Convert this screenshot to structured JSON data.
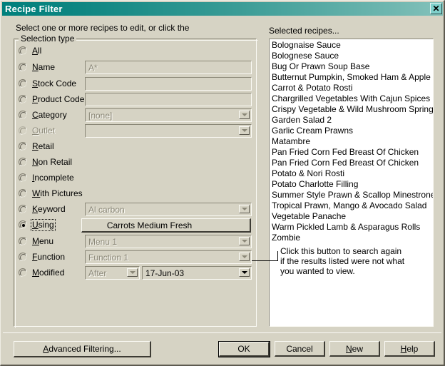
{
  "window": {
    "title": "Recipe Filter",
    "close_icon": "close-icon",
    "close_glyph": "✕",
    "colors": {
      "titlebar_from": "#00807c",
      "titlebar_to": "#84c2bb",
      "dialog_face": "#d6d3c4",
      "disabled_text": "#8b8878",
      "list_bg": "#ffffff"
    }
  },
  "prompt": "Select one or more recipes to edit, or click the",
  "list_caption": "Selected recipes...",
  "groupbox": {
    "label": "Selection type",
    "rows": [
      {
        "label": "All",
        "mnemonic": "A",
        "selected": false,
        "disabled": false,
        "control": "none"
      },
      {
        "label": "Name",
        "mnemonic": "N",
        "selected": false,
        "disabled": false,
        "control": "text",
        "value": "A*",
        "control_disabled": true
      },
      {
        "label": "Stock Code",
        "mnemonic": "S",
        "selected": false,
        "disabled": false,
        "control": "text",
        "value": "",
        "control_disabled": true
      },
      {
        "label": "Product Code",
        "mnemonic": "P",
        "selected": false,
        "disabled": false,
        "control": "text",
        "value": "",
        "control_disabled": true
      },
      {
        "label": "Category",
        "mnemonic": "C",
        "selected": false,
        "disabled": false,
        "control": "combo",
        "value": "[none]",
        "control_disabled": true
      },
      {
        "label": "Outlet",
        "mnemonic": "O",
        "selected": false,
        "disabled": true,
        "control": "combo",
        "value": "",
        "control_disabled": true
      },
      {
        "label": "Retail",
        "mnemonic": "R",
        "selected": false,
        "disabled": false,
        "control": "none"
      },
      {
        "label": "Non Retail",
        "mnemonic": "N",
        "selected": false,
        "disabled": false,
        "control": "none"
      },
      {
        "label": "Incomplete",
        "mnemonic": "I",
        "selected": false,
        "disabled": false,
        "control": "none"
      },
      {
        "label": "With Pictures",
        "mnemonic": "W",
        "selected": false,
        "disabled": false,
        "control": "none"
      },
      {
        "label": "Keyword",
        "mnemonic": "K",
        "selected": false,
        "disabled": false,
        "control": "combo",
        "value": "Al carbon",
        "control_disabled": true
      },
      {
        "label": "Using",
        "mnemonic": "U",
        "selected": true,
        "disabled": false,
        "control": "button",
        "value": "Carrots Medium Fresh",
        "control_disabled": false
      },
      {
        "label": "Menu",
        "mnemonic": "M",
        "selected": false,
        "disabled": false,
        "control": "combo",
        "value": "Menu 1",
        "control_disabled": true
      },
      {
        "label": "Function",
        "mnemonic": "F",
        "selected": false,
        "disabled": false,
        "control": "combo",
        "value": "Function 1",
        "control_disabled": true
      },
      {
        "label": "Modified",
        "mnemonic": "M",
        "selected": false,
        "disabled": false,
        "control": "date",
        "value": "After",
        "value2": "17-Jun-03",
        "control_disabled": true,
        "control2_disabled": false
      }
    ]
  },
  "recipes": [
    "Bolognaise Sauce",
    "Bolognese Sauce",
    "Bug Or Prawn Soup Base",
    "Butternut Pumpkin, Smoked Ham & Apple Bisque",
    "Carrot & Potato Rosti",
    "Chargrilled Vegetables With Cajun Spices",
    "Crispy Vegetable & Wild Mushroom Spring Rolls",
    "Garden Salad 2",
    "Garlic Cream Prawns",
    "Matambre",
    "Pan Fried Corn Fed Breast Of Chicken",
    "Pan Fried Corn Fed Breast Of Chicken",
    "Potato & Nori Rosti",
    "Potato Charlotte Filling",
    "Summer Style Prawn & Scallop Minestrone Soup",
    "Tropical Prawn, Mango & Avocado Salad",
    "Vegetable Panache",
    "Warm Pickled Lamb & Asparagus Rolls",
    "Zombie"
  ],
  "annotation": {
    "line1": "Click this button to search again",
    "line2": "if the results listed were not what",
    "line3": "you wanted to view."
  },
  "buttons": {
    "advanced_filtering": "Advanced Filtering...",
    "advanced_filtering_mnemonic": "A",
    "ok": "OK",
    "cancel": "Cancel",
    "new": "New",
    "new_mnemonic": "N",
    "help": "Help",
    "help_mnemonic": "H"
  }
}
